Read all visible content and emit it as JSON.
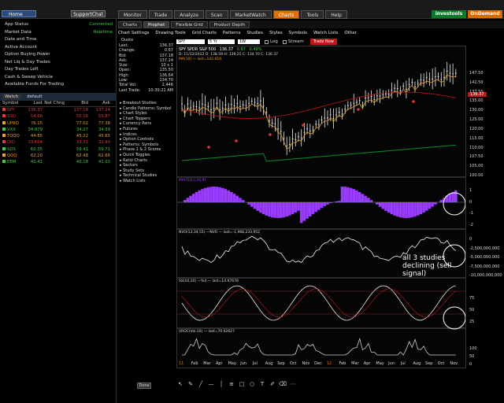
{
  "topbar": {
    "home_label": "Home",
    "support_label": "SupportChat",
    "tabs": [
      "Monitor",
      "Trade",
      "Analyze",
      "Scan",
      "MarketWatch",
      "Charts",
      "Tools",
      "Help"
    ],
    "active_tab": "Charts",
    "brand": "investools",
    "ondemand": "OnDemand"
  },
  "account": {
    "rows": [
      {
        "label": "App Status",
        "value": "Connected"
      },
      {
        "label": "Market Data",
        "value": "Realtime"
      },
      {
        "label": "Date and Time",
        "value": ""
      },
      {
        "label": "Active Account",
        "value": ""
      },
      {
        "label": "Option Buying Power",
        "value": ""
      },
      {
        "label": "Net Liq & Day Trades",
        "value": ""
      },
      {
        "label": "Day Trades Left",
        "value": ""
      },
      {
        "label": "Cash & Sweep Vehicle",
        "value": ""
      },
      {
        "label": "Available Funds For Trading",
        "value": ""
      }
    ]
  },
  "watchlist": {
    "name": "default",
    "link_label": "Watch",
    "columns": [
      "Symbol",
      "Last",
      "Net Chng",
      "Bid",
      "Ask"
    ],
    "rows": [
      {
        "sym": "SPY",
        "last": "136.37",
        "chg": "",
        "bid": "137.18",
        "ask": "137.24",
        "color": "#e23a3a"
      },
      {
        "sym": "SSO",
        "last": "54.66",
        "chg": "",
        "bid": "55.16",
        "ask": "55.87",
        "color": "#e23a3a"
      },
      {
        "sym": "UPRO",
        "last": "76.15",
        "chg": "",
        "bid": "77.02",
        "ask": "77.38",
        "color": "#e8a020"
      },
      {
        "sym": "VXX",
        "last": "34.879",
        "chg": "",
        "bid": "34.27",
        "ask": "34.39",
        "color": "#3ccf3c"
      },
      {
        "sym": "TQQQ",
        "last": "44.85",
        "chg": "",
        "bid": "45.22",
        "ask": "45.65",
        "color": "#e8a020"
      },
      {
        "sym": "QID",
        "last": "33.664",
        "chg": "",
        "bid": "33.71",
        "ask": "32.90",
        "color": "#e23a3a"
      },
      {
        "sym": "SDS",
        "last": "60.35",
        "chg": "",
        "bid": "59.41",
        "ask": "59.71",
        "color": "#3ccf3c"
      },
      {
        "sym": "QQQ",
        "last": "62.20",
        "chg": "",
        "bid": "62.48",
        "ask": "62.66",
        "color": "#e8a020"
      },
      {
        "sym": "EEM",
        "last": "40.41",
        "chg": "",
        "bid": "40.18",
        "ask": "41.03",
        "color": "#3ccf3c"
      }
    ]
  },
  "chart_tabs": {
    "items": [
      "Charts",
      "Prophet",
      "Flexible Grid",
      "Product Depth"
    ],
    "active": "Prophet"
  },
  "menu": {
    "items": [
      "Chart Settings",
      "Drawing Tools",
      "Grid Charts",
      "Patterns",
      "Studies",
      "Styles",
      "Symbols",
      "Watch Lists",
      "Other"
    ],
    "symbol": "SPY",
    "period": "5 Yr",
    "agg": "1W",
    "log_label": "Log",
    "stream_label": "Stream",
    "trade_now": "Trade Now"
  },
  "quote": {
    "title": "Quote",
    "rows": [
      {
        "label": "Last:",
        "value": "136.37"
      },
      {
        "label": "Change:",
        "value": "0.67"
      },
      {
        "label": "Bid:",
        "value": "137.18"
      },
      {
        "label": "Ask:",
        "value": "137.24"
      },
      {
        "label": "Size:",
        "value": "10 x 1"
      },
      {
        "label": "Open:",
        "value": "135.50"
      },
      {
        "label": "High:",
        "value": "136.64"
      },
      {
        "label": "Low:",
        "value": "134.70"
      },
      {
        "label": "Total Vol:",
        "value": "2,446"
      },
      {
        "label": "Last Trade:",
        "value": "10:30:21 AM"
      }
    ]
  },
  "studies": {
    "items": [
      "Breakout Studies",
      "Candle Patterns: Symbol",
      "Chart Styles",
      "Chart Toppers",
      "Currency Pairs",
      "Futures",
      "Indices",
      "Option Controls",
      "Patterns: Symbols",
      "Phase 1 & 2 Scores",
      "Quick Toggles",
      "Ratio Charts",
      "Sectors",
      "Study Sets",
      "Technical Studies",
      "Watch Lists"
    ],
    "done": "Done"
  },
  "chart_header": {
    "title": "SPY SPDR S&P 500",
    "last": "136.37",
    "change": "0.67",
    "pct": "0.49%",
    "line2": "D: 11/12/2012 O: 138.59 H: 139.25 C: 134.70 C: 136.37",
    "line3": "MA(10) — last=142.616",
    "macd_label": "MACD(12,26,9)",
    "nvo_label": "NVO(13,34,55) —NVO — last=-1,968,233,952",
    "ss_label": "SS(10,10) —%d — last=14.67678",
    "vroc_label": "VROC(Vol,10) — last=70.62627"
  },
  "annotation": "all 3 studies declining (sell signal)",
  "x_axis": [
    "11",
    "Feb",
    "Mar",
    "Apr",
    "May",
    "Jun",
    "Jul",
    "Aug",
    "Sep",
    "Oct",
    "Nov",
    "Dec",
    "12",
    "Feb",
    "Mar",
    "Apr",
    "May",
    "Jun",
    "Jul",
    "Aug",
    "Sep",
    "Oct",
    "Nov"
  ],
  "price_axis": [
    "147.50",
    "142.50",
    "137.50",
    "135.00",
    "130.00",
    "125.00",
    "120.00",
    "115.00",
    "110.00",
    "107.50",
    "105.00",
    "100.00"
  ],
  "price_highlight": "136.37",
  "macd_axis": [
    "1",
    "0",
    "-1",
    "-2"
  ],
  "nvo_axis": [
    "0",
    "-2,500,000,000",
    "-5,000,000,000",
    "-7,500,000,000",
    "-10,000,000,000"
  ],
  "ss_axis": [
    "75",
    "50",
    "25"
  ],
  "vroc_axis": [
    "100",
    "50",
    "0"
  ],
  "colors": {
    "accent": "#e56f00",
    "up": "#3ccf3c",
    "down": "#e23a3a",
    "macd": "#9a3cff"
  }
}
